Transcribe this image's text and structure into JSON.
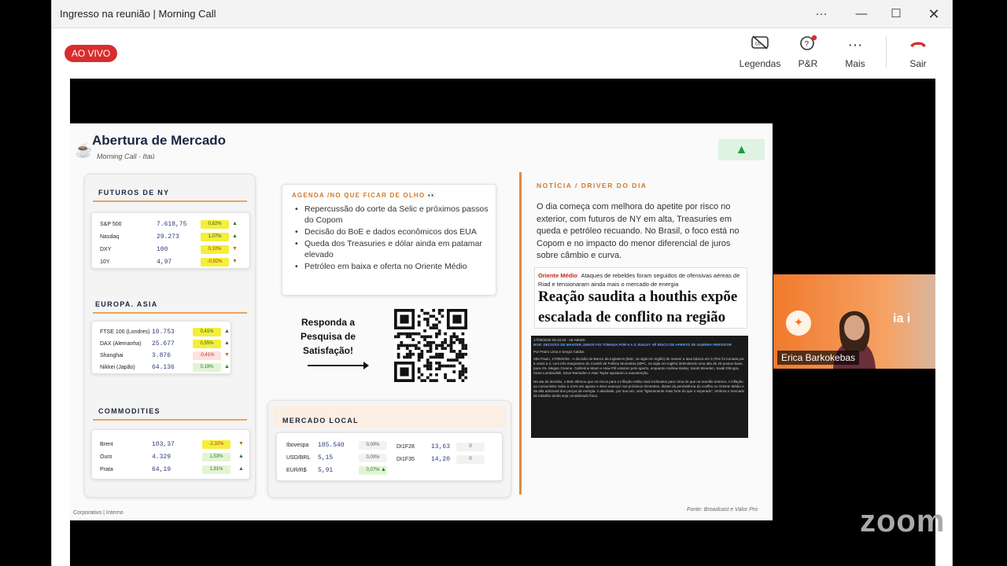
{
  "window": {
    "title": "Ingresso na reunião | Morning Call"
  },
  "toolbar": {
    "live": "AO VIVO",
    "captions": "Legendas",
    "qa": "P&R",
    "more": "Mais",
    "leave": "Sair"
  },
  "slide": {
    "title": "Abertura de Mercado",
    "subtitle": "Morning Call · Itaú",
    "futuros": {
      "header": "FUTUROS DE NY",
      "rows": [
        {
          "name": "S&P 500",
          "value": "7.618,75",
          "pct": "0,82%",
          "arrow": "▲"
        },
        {
          "name": "Nasdaq",
          "value": "29.273",
          "pct": "1,07%",
          "arrow": "▲"
        },
        {
          "name": "DXY",
          "value": "100",
          "pct": "0,10%",
          "arrow": "▼"
        },
        {
          "name": "10Y",
          "value": "4,97",
          "pct": "-0,92%",
          "arrow": "▼"
        }
      ]
    },
    "europa": {
      "header": "EUROPA. ASIA",
      "rows": [
        {
          "name": "FTSE 100 (Londres)",
          "value": "10.753",
          "pct": "0,41%",
          "arrow": "▲"
        },
        {
          "name": "DAX (Alemanha)",
          "value": "25.677",
          "pct": "0,55%",
          "arrow": "▲"
        },
        {
          "name": "Shanghai",
          "value": "3.876",
          "pct": "-0,41%",
          "arrow": "▼"
        },
        {
          "name": "Nikkei (Japão)",
          "value": "64.136",
          "pct": "0,19%",
          "arrow": "▲"
        }
      ]
    },
    "commodities": {
      "header": "COMMODITIES",
      "rows": [
        {
          "name": "Brent",
          "value": "103,37",
          "pct": "-2,32%",
          "arrow": "▼"
        },
        {
          "name": "Ouro",
          "value": "4.329",
          "pct": "1,53%",
          "arrow": "▲"
        },
        {
          "name": "Prata",
          "value": "64,19",
          "pct": "1,91%",
          "arrow": "▲"
        }
      ]
    },
    "agenda": {
      "header": "AGENDA /NO QUE FICAR DE OLHO 👀",
      "items": [
        "Repercussão do corte da Selic e próximos passos do Copom",
        "Decisão do BoE e dados econômicos dos EUA",
        "Queda dos Treasuries e dólar ainda em patamar elevado",
        "Petróleo em baixa e oferta no Oriente Médio"
      ]
    },
    "survey": "Responda a Pesquisa de Satisfação!",
    "mercado_local": {
      "header": "MERCADO LOCAL",
      "left": [
        {
          "name": "Ibovespa",
          "value": "185.540",
          "pct": "0,00%"
        },
        {
          "name": "USD/BRL",
          "value": "5,15",
          "pct": "0,00%"
        },
        {
          "name": "EUR/R$",
          "value": "5,91",
          "pct": "0,07%",
          "arrow": "▲"
        }
      ],
      "right": [
        {
          "name": "DI1F28",
          "value": "13,63",
          "pct": "0"
        },
        {
          "name": "DI1F35",
          "value": "14,20",
          "pct": "0"
        }
      ]
    },
    "news": {
      "header": "NOTÍCIA / DRIVER DO DIA",
      "text": "O dia começa com melhora do apetite por risco no exterior, com futuros de NY em alta, Treasuries em queda e petróleo recuando. No Brasil, o foco está no Copom e no impacto do menor diferencial de juros sobre câmbio e curva.",
      "clip_kicker": "Oriente Médio",
      "clip_kicker_text": "Ataques de rebeldes foram seguidos de ofensivas aéreas de Riad e tensionaram ainda mais o mercado de energia",
      "clip_headline": "Reação saudita a houthis expõe escalada de conflito na região",
      "clip2_meta": "17/09/2026 08:18:18 · AE NEWS",
      "clip2_title": "BOE: DECISÃO DE MANTER JUROS FOI TOMADA POR 6 A 3; BAILEY VÊ RISCO DE APERTO SE GUERRA PERSISTIR",
      "clip2_byline": "Por Pedro Lima e Sergio Caldas",
      "clip2_body1": "São Paulo, 17/09/2026 - A decisão do Banco da Inglaterra (BoE, na sigla em inglês) de manter a taxa básica em 3,75% foi tomada por 6 votos a 3, com três integrantes do Comitê de Política Monetária (MPC, na sigla em inglês) defendendo uma alta de 25 pontos-base, para 4%. Megan Greene, Catherine Mann e Huw Pill votaram pelo aperto, enquanto Andrew Bailey, Sarah Breeden, Swati Dhingra, Clare Lombardelli, Dave Ramsden e Alan Taylor apoiaram a manutenção.",
      "clip2_body2": "Na ata da decisão, o BoE afirmou que os riscos para a inflação estão mais inclinados para cima do que na reunião anterior. A inflação ao consumidor subiu a 3,5% em agosto e deve avançar nos próximos trimestres, diante da persistência do conflito no Oriente Médio e da alta adicional dos preços de energia. A atividade, por sua vez, veio \"ligeiramente mais forte do que o esperado\", embora o mercado de trabalho ainda seja considerado fraco."
    },
    "footer_left": "Corporativo | Interno",
    "footer_right": "Fonte: Broadcast  e Valor Pro"
  },
  "participant": {
    "name": "Erica Barkokebas",
    "logo": "ia i"
  },
  "brand": "zoom",
  "colors": {
    "live": "#d92d2d",
    "accent": "#e08a3a",
    "navy": "#1d2540",
    "up": "#e3f4d4",
    "down": "#fde1de",
    "highlight": "#f4ef3a"
  }
}
